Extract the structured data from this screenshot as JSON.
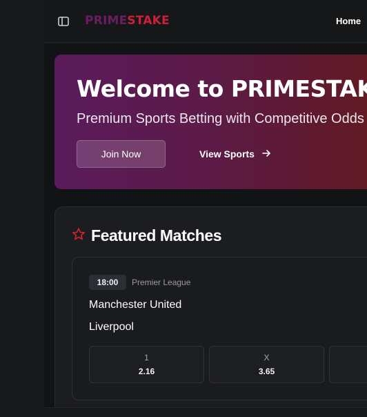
{
  "header": {
    "logo_prime": "PRIME",
    "logo_stake": "STAKE",
    "nav_home": "Home",
    "sidebar_toggle_icon": "sidebar-toggle-icon"
  },
  "hero": {
    "title": "Welcome to PRIMESTAKE",
    "subtitle": "Premium Sports Betting with Competitive Odds",
    "join_label": "Join Now",
    "view_sports_label": "View Sports",
    "arrow_icon": "arrow-right-icon"
  },
  "featured": {
    "title": "Featured Matches",
    "star_icon": "star-icon",
    "star_color": "#d8202e",
    "match": {
      "time": "18:00",
      "league": "Premier League",
      "home_team": "Manchester United",
      "away_team": "Liverpool",
      "odds": [
        {
          "label": "1",
          "value": "2.16"
        },
        {
          "label": "X",
          "value": "3.65"
        },
        {
          "label": "",
          "value": ""
        }
      ]
    }
  },
  "colors": {
    "background": "#161719",
    "brand_prime": "#6b1d63",
    "brand_stake": "#cc1f38",
    "card": "#1c1d21"
  }
}
